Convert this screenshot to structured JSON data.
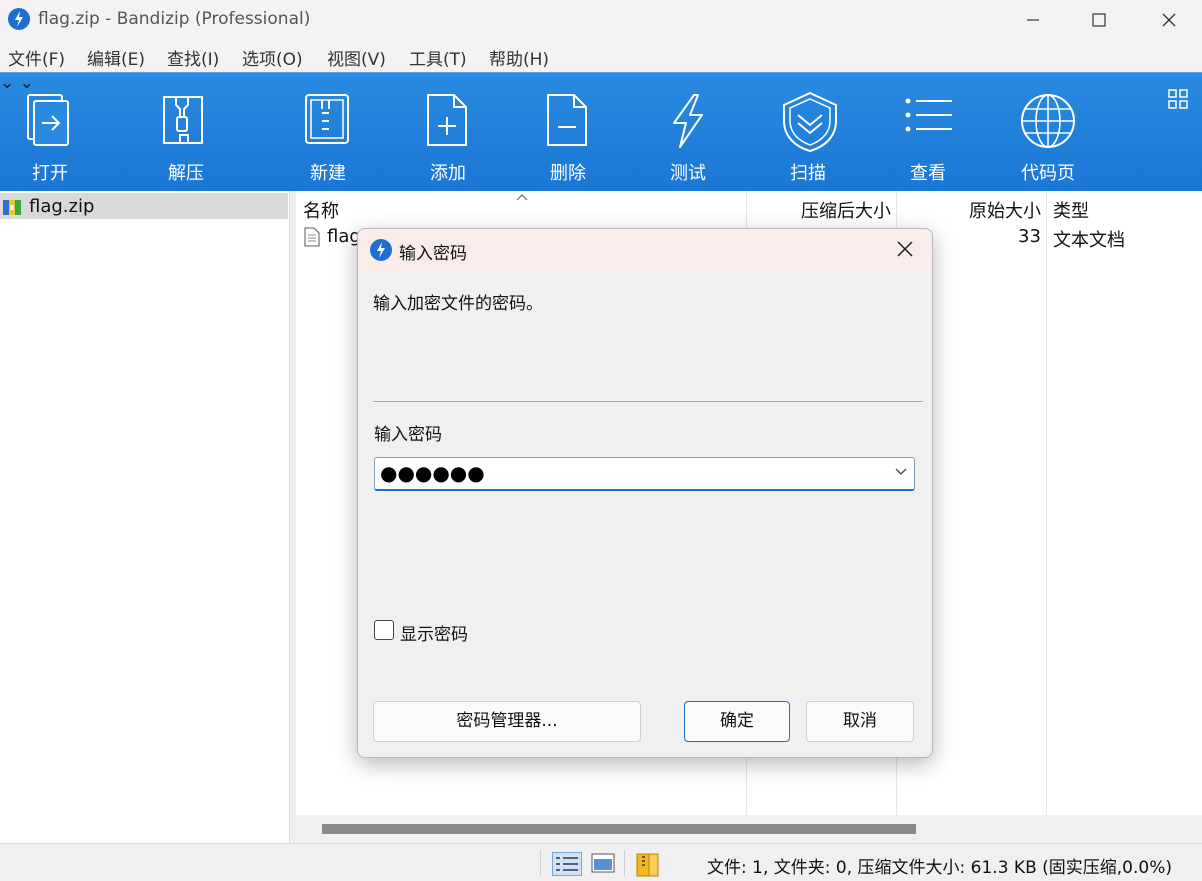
{
  "window": {
    "title": "flag.zip - Bandizip (Professional)",
    "icon": "bandizip-logo-icon",
    "controls": [
      "minimize-icon",
      "maximize-icon",
      "close-icon"
    ]
  },
  "menu": [
    "文件(F)",
    "编辑(E)",
    "查找(I)",
    "选项(O)",
    "视图(V)",
    "工具(T)",
    "帮助(H)"
  ],
  "toolbar": {
    "open": "打开",
    "extract": "解压",
    "new": "新建",
    "add": "添加",
    "delete": "删除",
    "test": "测试",
    "scan": "扫描",
    "view": "查看",
    "codepage": "代码页",
    "accent": "#1f7bd8"
  },
  "tree": {
    "items": [
      {
        "label": "flag.zip",
        "icon": "zip-archive-icon"
      }
    ]
  },
  "list": {
    "columns": {
      "name": "名称",
      "packed": "压缩后大小",
      "original": "原始大小",
      "type": "类型"
    },
    "rows": [
      {
        "name": "flag",
        "packed": "",
        "original": "33",
        "type": "文本文档"
      }
    ]
  },
  "status": {
    "text": "文件: 1, 文件夹: 0, 压缩文件大小: 61.3 KB (固实压缩,0.0%)"
  },
  "dialog": {
    "title": "输入密码",
    "message": "输入加密文件的密码。",
    "field_label": "输入密码",
    "password_value": "●●●●●●",
    "show_password_label": "显示密码",
    "show_password_checked": false,
    "buttons": {
      "manager": "密码管理器...",
      "ok": "确定",
      "cancel": "取消"
    }
  }
}
